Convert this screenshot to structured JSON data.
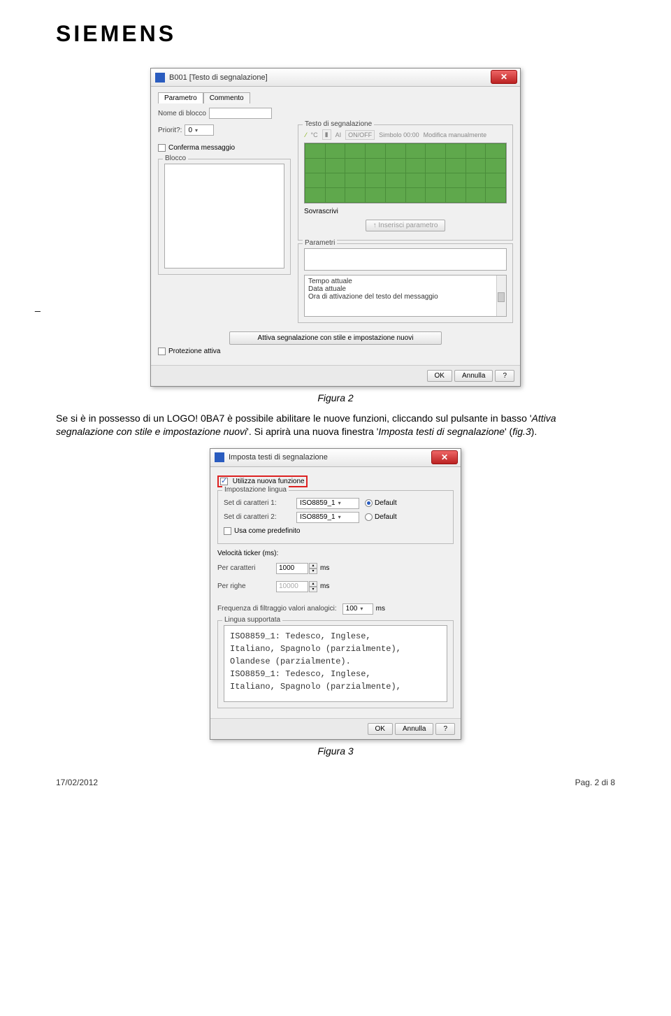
{
  "brand": "SIEMENS",
  "dash": "_",
  "dialog1": {
    "title": "B001 [Testo di segnalazione]",
    "tabs": {
      "param": "Parametro",
      "comment": "Commento"
    },
    "blockname_label": "Nome di blocco",
    "prio_label": "Priorit?:",
    "prio_value": "0",
    "confirm_label": "Conferma messaggio",
    "fs_blocco": "Blocco",
    "fs_testo": "Testo di segnalazione",
    "iconsbar": {
      "c": "°C",
      "ai": "AI",
      "onoff": "ON/OFF",
      "symbol": "Simbolo 00:00",
      "mod": "Modifica manualmente"
    },
    "sovrascrivi": "Sovrascrivi",
    "insert_param": "Inserisci parametro",
    "fs_param": "Parametri",
    "param_lines": [
      "Tempo attuale",
      "Data attuale",
      "Ora di attivazione del testo del messaggio"
    ],
    "gray_btn": "Attiva segnalazione con stile e impostazione nuovi",
    "protezione": "Protezione attiva",
    "ok": "OK",
    "cancel": "Annulla",
    "help": "?"
  },
  "caption1": "Figura 2",
  "para1_a": "Se si è in possesso di un LOGO! 0BA7 è possibile abilitare le nuove funzioni, cliccando sul pulsante in basso '",
  "para1_i": "Attiva segnalazione con stile e impostazione nuovi",
  "para1_b": "'. Si aprirà una nuova finestra '",
  "para1_i2": "Imposta testi di segnalazione",
  "para1_c": "' (",
  "para1_i3": "fig.3",
  "para1_d": ").",
  "dialog2": {
    "title": "Imposta testi di segnalazione",
    "use_new": "Utilizza nuova funzione",
    "fs_lang": "Impostazione lingua",
    "set1_label": "Set di caratteri 1:",
    "set2_label": "Set di caratteri 2:",
    "set_value": "ISO8859_1",
    "default": "Default",
    "use_default": "Usa come predefinito",
    "ticker_label": "Velocità ticker (ms):",
    "per_car_label": "Per caratteri",
    "per_car_val": "1000",
    "per_righe_label": "Per righe",
    "per_righe_val": "10000",
    "ms": "ms",
    "freq_label": "Frequenza di filtraggio valori analogici:",
    "freq_val": "100",
    "fs_supported": "Lingua supportata",
    "lang_text_1": "ISO8859_1: Tedesco, Inglese,",
    "lang_text_2": "Italiano, Spagnolo (parzialmente),",
    "lang_text_3": "Olandese (parzialmente).",
    "lang_text_4": "ISO8859_1: Tedesco, Inglese,",
    "lang_text_5": "Italiano, Spagnolo (parzialmente),",
    "ok": "OK",
    "cancel": "Annulla",
    "help": "?"
  },
  "caption2": "Figura 3",
  "footer": {
    "date": "17/02/2012",
    "page": "Pag. 2 di 8"
  }
}
